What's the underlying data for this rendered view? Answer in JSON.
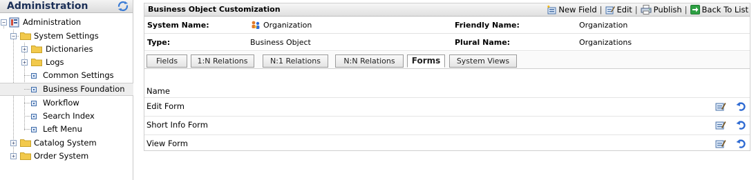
{
  "sidebar": {
    "title": "Administration",
    "tree": [
      {
        "label": "Administration"
      },
      {
        "label": "System Settings"
      },
      {
        "label": "Dictionaries"
      },
      {
        "label": "Logs"
      },
      {
        "label": "Common Settings"
      },
      {
        "label": "Business Foundation",
        "selected": true
      },
      {
        "label": "Workflow"
      },
      {
        "label": "Search Index"
      },
      {
        "label": "Left Menu"
      },
      {
        "label": "Catalog System"
      },
      {
        "label": "Order System"
      }
    ]
  },
  "main": {
    "title": "Business Object Customization",
    "toolbar": {
      "new_field": "New Field",
      "edit": "Edit",
      "publish": "Publish",
      "back": "Back To List",
      "separator": "|"
    },
    "properties": {
      "system_name_label": "System Name:",
      "system_name_value": "Organization",
      "type_label": "Type:",
      "type_value": "Business Object",
      "friendly_name_label": "Friendly Name:",
      "friendly_name_value": "Organization",
      "plural_name_label": "Plural Name:",
      "plural_name_value": "Organizations"
    },
    "tabs": [
      {
        "label": "Fields"
      },
      {
        "label": "1:N Relations"
      },
      {
        "label": "N:1 Relations"
      },
      {
        "label": "N:N Relations"
      },
      {
        "label": "Forms",
        "active": true
      },
      {
        "label": "System Views"
      }
    ],
    "grid": {
      "header": "Name",
      "rows": [
        {
          "name": "Edit Form"
        },
        {
          "name": "Short Info Form"
        },
        {
          "name": "View Form"
        }
      ]
    }
  },
  "colors": {
    "title_blue": "#1b2f57",
    "folder_yellow": "#f2c94c",
    "icon_blue": "#2f6bd3"
  }
}
